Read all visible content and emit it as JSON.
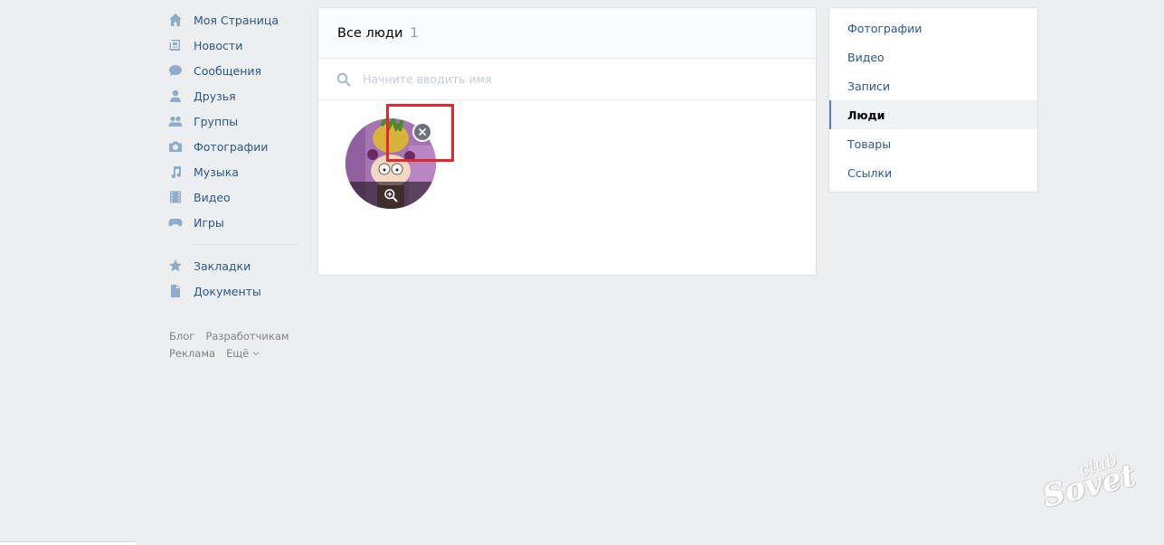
{
  "nav": {
    "items": [
      {
        "label": "Моя Страница",
        "icon": "home-icon"
      },
      {
        "label": "Новости",
        "icon": "news-icon"
      },
      {
        "label": "Сообщения",
        "icon": "messages-icon"
      },
      {
        "label": "Друзья",
        "icon": "friends-icon"
      },
      {
        "label": "Группы",
        "icon": "groups-icon"
      },
      {
        "label": "Фотографии",
        "icon": "camera-icon"
      },
      {
        "label": "Музыка",
        "icon": "music-icon"
      },
      {
        "label": "Видео",
        "icon": "video-icon"
      },
      {
        "label": "Игры",
        "icon": "games-icon"
      }
    ],
    "secondary_items": [
      {
        "label": "Закладки",
        "icon": "star-icon"
      },
      {
        "label": "Документы",
        "icon": "document-icon"
      }
    ]
  },
  "footer": {
    "blog": "Блог",
    "developers": "Разработчикам",
    "ads": "Реклама",
    "more": "Ещё"
  },
  "main": {
    "title": "Все люди",
    "count": "1",
    "search_placeholder": "Начните вводить имя",
    "search_value": ""
  },
  "right_menu": {
    "items": [
      {
        "label": "Фотографии",
        "active": false
      },
      {
        "label": "Видео",
        "active": false
      },
      {
        "label": "Записи",
        "active": false
      },
      {
        "label": "Люди",
        "active": true
      },
      {
        "label": "Товары",
        "active": false
      },
      {
        "label": "Ссылки",
        "active": false
      }
    ]
  },
  "watermark": {
    "line1": "club",
    "line2": "Sovet"
  },
  "colors": {
    "background": "#edeef0",
    "link": "#2a5885",
    "accent": "#5181b8",
    "highlight": "#e3262c",
    "icon": "#8fadc8"
  }
}
